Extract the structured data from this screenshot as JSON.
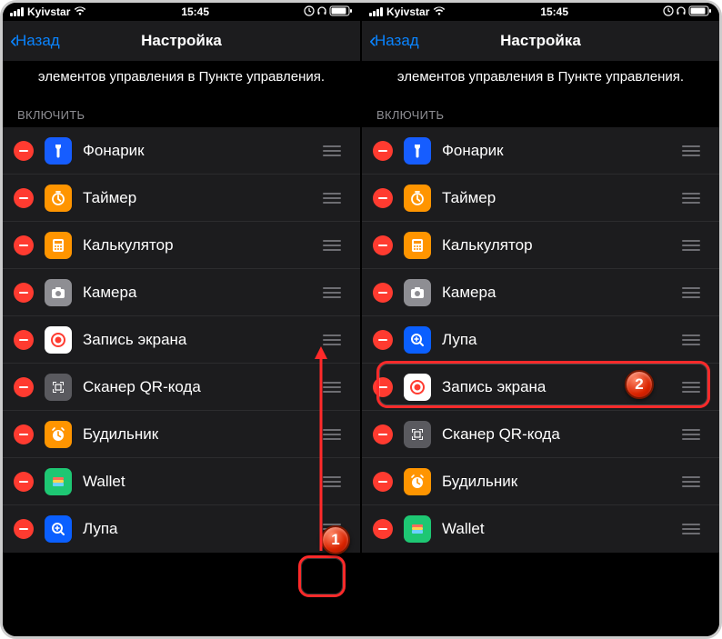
{
  "status": {
    "carrier": "Kyivstar",
    "time": "15:45"
  },
  "nav": {
    "back": "Назад",
    "title": "Настройка"
  },
  "subtitle": "элементов управления в Пункте управления.",
  "sectionHeader": "ВКЛЮЧИТЬ",
  "badges": {
    "one": "1",
    "two": "2"
  },
  "left": {
    "items": [
      {
        "label": "Фонарик",
        "icon": "flashlight"
      },
      {
        "label": "Таймер",
        "icon": "timer"
      },
      {
        "label": "Калькулятор",
        "icon": "calculator"
      },
      {
        "label": "Камера",
        "icon": "camera"
      },
      {
        "label": "Запись экрана",
        "icon": "record"
      },
      {
        "label": "Сканер QR-кода",
        "icon": "qr"
      },
      {
        "label": "Будильник",
        "icon": "alarm"
      },
      {
        "label": "Wallet",
        "icon": "wallet"
      },
      {
        "label": "Лупа",
        "icon": "magnifier"
      }
    ]
  },
  "right": {
    "items": [
      {
        "label": "Фонарик",
        "icon": "flashlight"
      },
      {
        "label": "Таймер",
        "icon": "timer"
      },
      {
        "label": "Калькулятор",
        "icon": "calculator"
      },
      {
        "label": "Камера",
        "icon": "camera"
      },
      {
        "label": "Лупа",
        "icon": "magnifier"
      },
      {
        "label": "Запись экрана",
        "icon": "record"
      },
      {
        "label": "Сканер QR-кода",
        "icon": "qr"
      },
      {
        "label": "Будильник",
        "icon": "alarm"
      },
      {
        "label": "Wallet",
        "icon": "wallet"
      }
    ]
  }
}
